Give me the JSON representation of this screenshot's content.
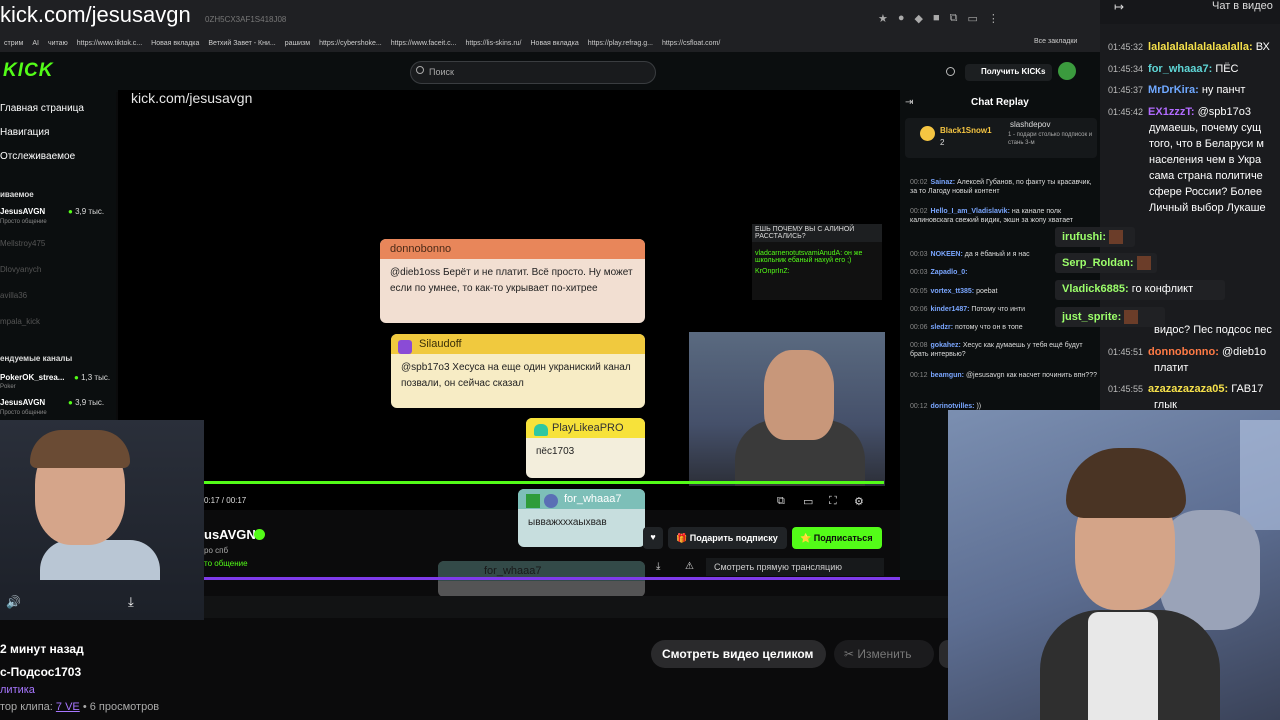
{
  "browser": {
    "url_overlay": "kick.com/jesusavgn",
    "address_ghost": "0ZH5CX3AF1S418J08",
    "bookmarks": [
      "стрим",
      "AI",
      "читаю",
      "https://www.tiktok.c...",
      "Новая вкладка",
      "Ветхий Завет - Кни...",
      "рашизм",
      "https://cybershoke...",
      "https://www.faceit.c...",
      "https://lis-skins.ru/",
      "Новая вкладка",
      "https://play.refrag.g...",
      "https://csfloat.com/"
    ],
    "bookmarks_all": "Все закладки"
  },
  "kick": {
    "logo": "KICK",
    "search_placeholder": "Поиск",
    "get_kicks": "Получить KICKs",
    "nav": [
      "Главная страница",
      "Навигация",
      "Отслеживаемое"
    ],
    "followed_title": "иваемое",
    "followed": [
      {
        "name": "JesusAVGN",
        "count": "3,9 тыс.",
        "sub": "Просто общение",
        "live": true
      },
      {
        "name": "Mellstroy475",
        "live": false
      },
      {
        "name": "Dlovyanych",
        "live": false
      },
      {
        "name": "avilla36",
        "live": false
      },
      {
        "name": "mpala_kick",
        "live": false
      }
    ],
    "recommended_title": "ендуемые каналы",
    "recommended": [
      {
        "name": "PokerOK_strea...",
        "count": "1,3 тыс.",
        "sub": "Poker"
      },
      {
        "name": "JesusAVGN",
        "count": "3,9 тыс.",
        "sub": "Просто общение"
      }
    ]
  },
  "video": {
    "url_text": "kick.com/jesusavgn",
    "time": "0:17 / 00:17",
    "messages": [
      {
        "user": "donnobonno",
        "text": "@dieb1oss Берёт и не платит. Всё просто. Ну может если по умнее, то как-то укрывает по-хитрее"
      },
      {
        "user": "Silaudoff",
        "text": "@spb17o3 Хесуса на еще один украниский канал позвали, он сейчас сказал"
      },
      {
        "user": "PlayLikeaPRO",
        "text": "пёс1703"
      },
      {
        "user": "for_whaaa7",
        "text": "ывважхххаыхвав"
      },
      {
        "user": "for_whaaa7",
        "text": ""
      }
    ],
    "small_chat": [
      "ЕШЬ ПОЧЕМУ ВЫ С АЛИНОЙ РАССТАЛИСЬ?",
      "vladcarnenotutsvamiAnudA: он же школьник ебаный нахуй его ;)",
      "KrOnprInZ:"
    ],
    "channel_name": "usAVGN",
    "channel_sub1": "ро спб",
    "channel_sub2": "то общение",
    "gift_label": "Подарить подписку",
    "subscribe_label": "Подписаться",
    "watch_live": "Смотреть прямую трансляцию"
  },
  "clip": {
    "time_ago": "2 минут назад",
    "title": "с-Подсос1703",
    "category": "литика",
    "author_prefix": "тор клипа:",
    "author": "7 VE",
    "views": " • 6 просмотров",
    "watch_full": "Смотреть видео целиком",
    "edit": "Изменить"
  },
  "chat_replay": {
    "title": "Chat Replay",
    "pinned_name": "Black1Snow1",
    "pinned_num": "2",
    "pinned_user2": "slashdepov",
    "pinned_text2": "1 - подари столько подписок и стань 3-м",
    "lines": [
      {
        "t": "00:02",
        "u": "Sainaz:",
        "m": "Алексей Губанов, по факту ты красавчик, за то Лагоду новый контент"
      },
      {
        "t": "00:02",
        "u": "Hello_I_am_Vladislavik:",
        "m": "на канале полк калиновскага свежий видик, экшн за жопу хватает"
      },
      {
        "t": "00:03",
        "u": "NOKEEN:",
        "m": "да я ёбаный и я нас"
      },
      {
        "t": "00:03",
        "u": "Zapadlo_0:",
        "m": ""
      },
      {
        "t": "00:05",
        "u": "vortex_tt385:",
        "m": "poebat"
      },
      {
        "t": "00:06",
        "u": "kinder1487:",
        "m": "Потому что инти"
      },
      {
        "t": "00:06",
        "u": "sledzr:",
        "m": "потому что он в топе"
      },
      {
        "t": "00:08",
        "u": "gokahez:",
        "m": "Хесус как думаешь у тебя ещё будут брать интервью?"
      },
      {
        "t": "00:12",
        "u": "beamgun:",
        "m": "@jesusavgn как насчет починить впн???"
      },
      {
        "t": "00:12",
        "u": "dorinotvilles:",
        "m": "))"
      }
    ]
  },
  "right_chat": {
    "title": "Чат в видео",
    "lines": [
      {
        "t": "01:45:32",
        "u": "lalalalalalalalaalalla:",
        "m": "ВХ",
        "c": "#f5e04b"
      },
      {
        "t": "01:45:34",
        "u": "for_whaaa7:",
        "m": "ПЁС",
        "c": "#5fd6d6"
      },
      {
        "t": "01:45:37",
        "u": "MrDrKira:",
        "m": "ну панчт",
        "c": "#6fa8ff"
      },
      {
        "t": "01:45:42",
        "u": "EX1zzzT:",
        "m": "@spb17o3",
        "c": "#b26bff"
      }
    ],
    "wrapped": [
      "думаешь, почему сущ",
      "того, что в Беларуси м",
      "населения чем в Укра",
      "сама страна политиче",
      "сфере России? Более ",
      "Личный выбор Лукаше"
    ],
    "highlights": [
      {
        "u": "irufushi:",
        "m": ""
      },
      {
        "u": "Serp_Roldan:",
        "m": ""
      },
      {
        "u": "Vladick6885:",
        "m": "го конфликт"
      },
      {
        "u": "just_sprite:",
        "m": ""
      }
    ],
    "tail": [
      {
        "t": "",
        "u": "",
        "m": "видос? Пес подсос пес",
        "c": "#fff"
      },
      {
        "t": "01:45:51",
        "u": "donnobonno:",
        "m": "@dieb1o",
        "c": "#ff7a45"
      },
      {
        "t": "",
        "u": "",
        "m": "платит",
        "c": "#fff"
      },
      {
        "t": "01:45:55",
        "u": "azazazazaza05:",
        "m": "ГАВ17",
        "c": "#f5e04b"
      },
      {
        "t": "",
        "u": "",
        "m": "глык",
        "c": "#fff"
      }
    ]
  },
  "colors": {
    "kick_green": "#53fc18",
    "purple": "#7f3bea"
  }
}
